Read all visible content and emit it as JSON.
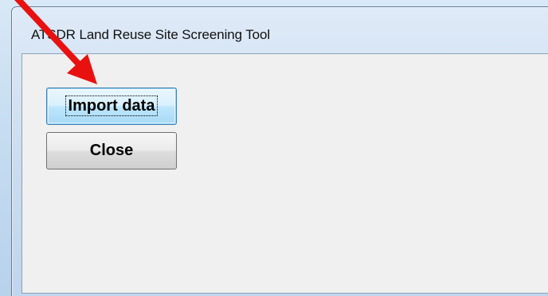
{
  "window": {
    "title": "ATSDR Land Reuse Site Screening Tool"
  },
  "buttons": {
    "import_label": "Import data",
    "close_label": "Close"
  },
  "annotation": {
    "arrow_color": "#e8110f",
    "icon": "pointer-arrow-icon"
  },
  "colors": {
    "window_frame": "#c9dcf0",
    "client_background": "#f0f0f0",
    "default_button_border": "#3c7fb1"
  }
}
